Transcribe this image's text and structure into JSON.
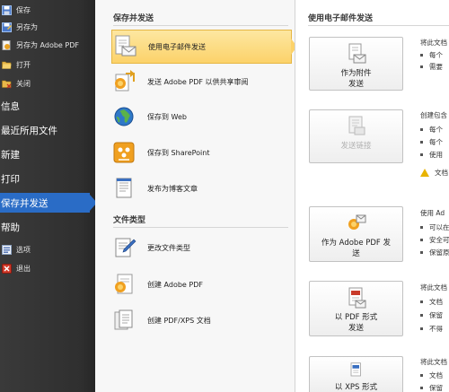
{
  "nav": {
    "top_items": [
      {
        "label": "保存"
      },
      {
        "label": "另存为"
      },
      {
        "label": "另存为 Adobe PDF"
      },
      {
        "label": "打开"
      },
      {
        "label": "关闭"
      }
    ],
    "main_items": [
      {
        "label": "信息"
      },
      {
        "label": "最近所用文件"
      },
      {
        "label": "新建"
      },
      {
        "label": "打印"
      },
      {
        "label": "保存并发送"
      },
      {
        "label": "帮助"
      }
    ],
    "bottom_items": [
      {
        "label": "选项"
      },
      {
        "label": "退出"
      }
    ],
    "active": "保存并发送"
  },
  "middle": {
    "section1_title": "保存并发送",
    "section1_items": [
      {
        "label": "使用电子邮件发送"
      },
      {
        "label": "发送 Adobe PDF 以供共享审阅"
      },
      {
        "label": "保存到 Web"
      },
      {
        "label": "保存到 SharePoint"
      },
      {
        "label": "发布为博客文章"
      }
    ],
    "section2_title": "文件类型",
    "section2_items": [
      {
        "label": "更改文件类型"
      },
      {
        "label": "创建 Adobe PDF"
      },
      {
        "label": "创建 PDF/XPS 文档"
      }
    ]
  },
  "right": {
    "title": "使用电子邮件发送",
    "buttons": [
      {
        "line1": "作为附件",
        "line2": "发送"
      },
      {
        "line1": "发送链接",
        "line2": ""
      },
      {
        "line1": "作为 Adobe PDF 发",
        "line2": "送"
      },
      {
        "line1": "以 PDF 形式",
        "line2": "发送"
      },
      {
        "line1": "以 XPS 形式",
        "line2": ""
      }
    ],
    "descs": [
      {
        "head": "将此文档",
        "bullets": [
          "每个",
          "需要"
        ]
      },
      {
        "head": "创建包含",
        "bullets": [
          "每个",
          "每个",
          "使用"
        ],
        "warning": "文档"
      },
      {
        "head": "使用 Ad",
        "bullets": [
          "可以在",
          "安全可",
          "保留原"
        ]
      },
      {
        "head": "将此文档",
        "bullets": [
          "文档",
          "保留",
          "不得"
        ]
      },
      {
        "head": "将此文档",
        "bullets": [
          "文档",
          "保留"
        ]
      }
    ]
  },
  "colors": {
    "nav_bg": "#333333",
    "nav_active": "#2a6cc6",
    "selected_bg": "#fcd26a"
  }
}
